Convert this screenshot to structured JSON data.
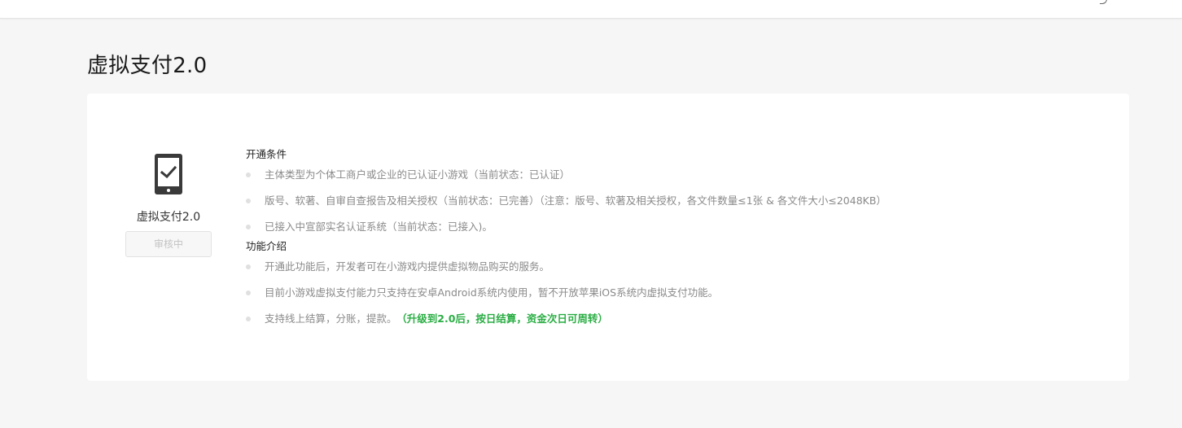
{
  "page": {
    "title": "虚拟支付2.0"
  },
  "feature": {
    "name": "虚拟支付2.0",
    "status_label": "审核中",
    "icon": "phone-check-icon"
  },
  "sections": {
    "conditions": {
      "title": "开通条件",
      "items": [
        "主体类型为个体工商户或企业的已认证小游戏（当前状态：已认证）",
        "版号、软著、自审自查报告及相关授权（当前状态：已完善）（注意：版号、软著及相关授权，各文件数量≤1张 & 各文件大小≤2048KB）",
        "已接入中宣部实名认证系统（当前状态：已接入)。"
      ]
    },
    "intro": {
      "title": "功能介绍",
      "items": [
        "开通此功能后，开发者可在小游戏内提供虚拟物品购买的服务。",
        "目前小游戏虚拟支付能力只支持在安卓Android系统内使用，暂不开放苹果iOS系统内虚拟支付功能。",
        "支持线上结算，分账，提款。"
      ],
      "highlight": "（升级到2.0后，按日结算，资金次日可周转）"
    }
  },
  "colors": {
    "background": "#f6f6f6",
    "card": "#ffffff",
    "highlight_green": "#2aae44",
    "muted_text": "#8a8a8a"
  }
}
